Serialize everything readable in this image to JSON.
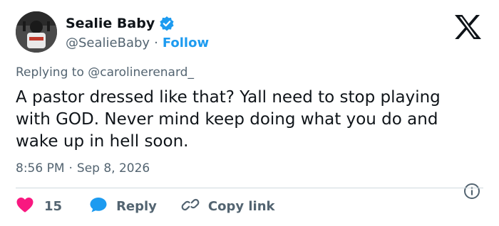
{
  "author": {
    "display_name": "Sealie Baby",
    "handle": "@SealieBaby",
    "separator": "·",
    "follow_label": "Follow"
  },
  "tweet": {
    "reply_prefix": "Replying to ",
    "reply_mention": "@carolinerenard_",
    "text": "A pastor dressed like that? Yall need to stop playing with GOD. Never mind keep doing what you do and wake up in hell soon.",
    "time": "8:56 PM",
    "date_separator": "·",
    "date": "Sep 8, 2026"
  },
  "actions": {
    "like_count": "15",
    "reply_label": "Reply",
    "copy_label": "Copy link"
  },
  "colors": {
    "accent": "#1d9bf0",
    "like": "#f91880",
    "secondary_text": "#536471",
    "primary_text": "#0f1419",
    "divider": "#cfd9de"
  },
  "icons": {
    "verified": "verified-badge-icon",
    "logo": "x-logo-icon",
    "info": "info-icon",
    "like": "heart-icon",
    "reply": "speech-bubble-icon",
    "copy": "link-icon"
  }
}
